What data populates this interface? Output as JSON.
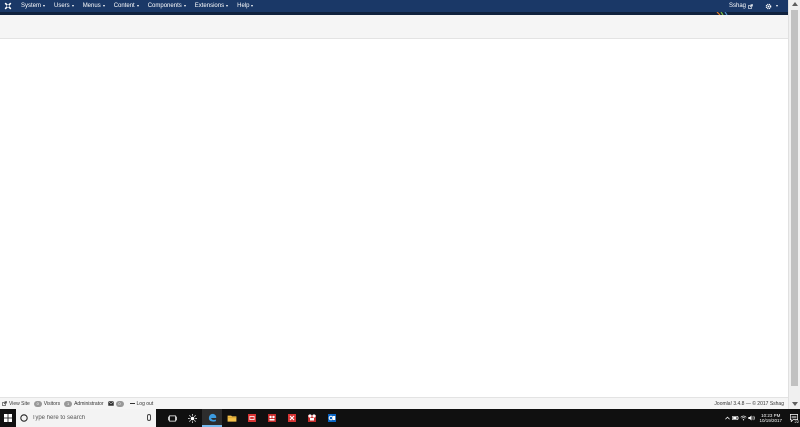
{
  "navbar": {
    "menus": [
      {
        "label": "System"
      },
      {
        "label": "Users"
      },
      {
        "label": "Menus"
      },
      {
        "label": "Content"
      },
      {
        "label": "Components"
      },
      {
        "label": "Extensions"
      },
      {
        "label": "Help"
      }
    ],
    "user": "Sshag",
    "icons": {
      "logo": "joomla-logo-icon",
      "user_link": "external-link-icon",
      "settings": "gear-icon"
    }
  },
  "statusbar": {
    "view_site": "View Site",
    "visitors_count": "0",
    "visitors_label": "Visitors",
    "admins_count": "1",
    "admins_label": "Administrator",
    "messages_count": "0",
    "logout": "Log out",
    "version": "Joomla! 3.4.8",
    "copyright": "— © 2017 Sshag"
  },
  "taskbar": {
    "search_placeholder": "Type here to search",
    "time": "10:23 PM",
    "date": "10/19/2017",
    "notification_count": "22",
    "apps": [
      {
        "icon": "task-view-icon"
      },
      {
        "icon": "cortana-light-icon"
      },
      {
        "icon": "edge-browser-icon"
      },
      {
        "icon": "file-explorer-icon"
      },
      {
        "icon": "red-app-icon"
      },
      {
        "icon": "red-app-2-icon"
      },
      {
        "icon": "red-app-3-icon"
      },
      {
        "icon": "red-app-4-icon"
      },
      {
        "icon": "outlook-icon"
      }
    ]
  },
  "colors": {
    "navbar_bg": "#1a3867",
    "taskbar_bg": "#101010",
    "subhead_bg": "#f5f5f5"
  }
}
